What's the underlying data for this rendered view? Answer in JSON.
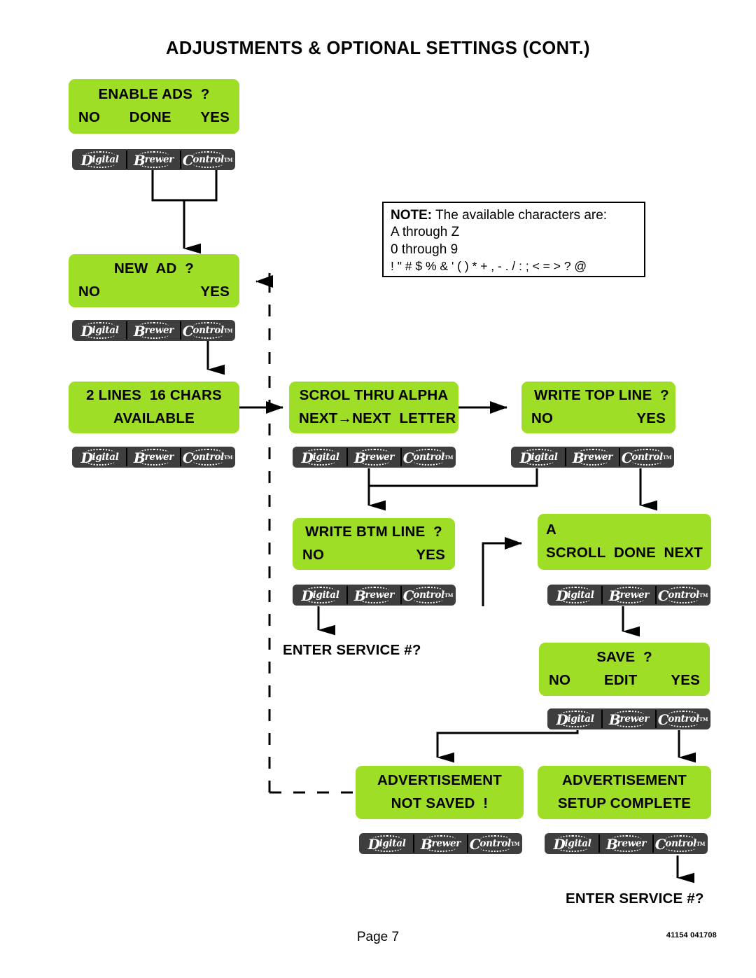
{
  "document": {
    "title": "ADJUSTMENTS & OPTIONAL SETTINGS (CONT.)",
    "page_label": "Page 7",
    "doc_code": "41154 041708",
    "accent_green": "#9ede26",
    "logo_dark": "#3e3e3e"
  },
  "logo": {
    "part1_cap": "D",
    "part1_rest": "igital",
    "part2_cap": "B",
    "part2_rest": "rewer",
    "part3_cap": "C",
    "part3_rest": "ontrol",
    "trademark": "TM"
  },
  "note": {
    "label": "NOTE:",
    "line1_rest": " The available characters are:",
    "line2": "A through Z",
    "line3": "0 through 9",
    "line4": "! \" # $ % & ' ( ) * + , - . / : ; < = > ? @"
  },
  "screens": {
    "enable_ads": {
      "line1": "ENABLE ADS  ?",
      "opt_no": "NO",
      "opt_done": "DONE",
      "opt_yes": "YES"
    },
    "new_ad": {
      "line1": "NEW  AD  ?",
      "opt_no": "NO",
      "opt_yes": "YES"
    },
    "two_lines": {
      "line1": "2 LINES  16 CHARS",
      "line2": "AVAILABLE"
    },
    "scroll_alpha": {
      "line1": "SCROL THRU ALPHA",
      "line2": "NEXT→NEXT  LETTER"
    },
    "write_top_line": {
      "line1": "WRITE TOP LINE  ?",
      "opt_no": "NO",
      "opt_yes": "YES"
    },
    "write_btm_line": {
      "line1": "WRITE BTM LINE  ?",
      "opt_no": "NO",
      "opt_yes": "YES"
    },
    "char_entry": {
      "line1": "A",
      "opt_scroll": "SCROLL",
      "opt_done": "DONE",
      "opt_next": "NEXT"
    },
    "save": {
      "line1": "SAVE  ?",
      "opt_no": "NO",
      "opt_edit": "EDIT",
      "opt_yes": "YES"
    },
    "not_saved": {
      "line1": "ADVERTISEMENT",
      "line2": "NOT SAVED  !"
    },
    "setup_complete": {
      "line1": "ADVERTISEMENT",
      "line2": "SETUP COMPLETE"
    },
    "enter_service_mid": {
      "text": "ENTER SERVICE #?"
    },
    "enter_service_bottom": {
      "text": "ENTER SERVICE #?"
    }
  }
}
